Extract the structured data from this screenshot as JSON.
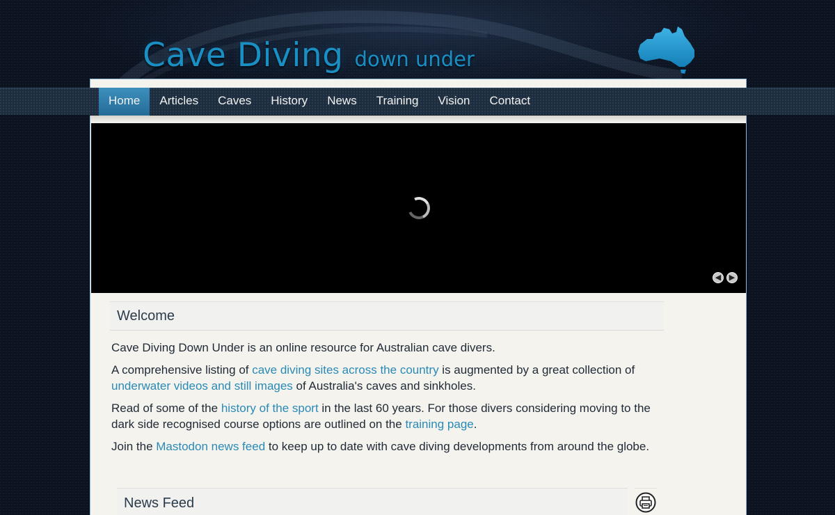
{
  "site": {
    "logo_main": "Cave Diving",
    "logo_sub": "down under",
    "map_icon": "australia-map-icon"
  },
  "nav": {
    "items": [
      {
        "label": "Home",
        "active": true
      },
      {
        "label": "Articles"
      },
      {
        "label": "Caves"
      },
      {
        "label": "History"
      },
      {
        "label": "News"
      },
      {
        "label": "Training"
      },
      {
        "label": "Vision"
      },
      {
        "label": "Contact"
      }
    ]
  },
  "slider": {
    "loading_icon": "loading-spinner-icon",
    "prev_icon": "arrow-left-icon",
    "next_icon": "arrow-right-icon"
  },
  "welcome": {
    "title": "Welcome",
    "p1": "Cave Diving Down Under is an online resource for Australian cave divers.",
    "p2_a": "A comprehensive listing of ",
    "p2_link1": "cave diving sites across the country",
    "p2_b": " is augmented by a great collection of",
    "p2_link2": "underwater videos and still images",
    "p2_c": " of Australia's caves and sinkholes.",
    "p3_a": "Read of some of the ",
    "p3_link1": "history of the sport",
    "p3_b": " in the last 60 years. For those divers considering moving to the",
    "p3_c": "dark side recognised course options are outlined on the ",
    "p3_link2": "training page",
    "p3_d": ".",
    "p4_a": "Join the ",
    "p4_link": "Mastodon news feed",
    "p4_b": " to keep up to date with cave diving developments from around the globe."
  },
  "news_feed": {
    "title": "News Feed",
    "print_icon": "print-icon"
  },
  "colors": {
    "accent": "#2a8ab5",
    "nav_active": "#2f7eac",
    "background": "#0b1220",
    "content_bg": "#f4f3ee"
  }
}
